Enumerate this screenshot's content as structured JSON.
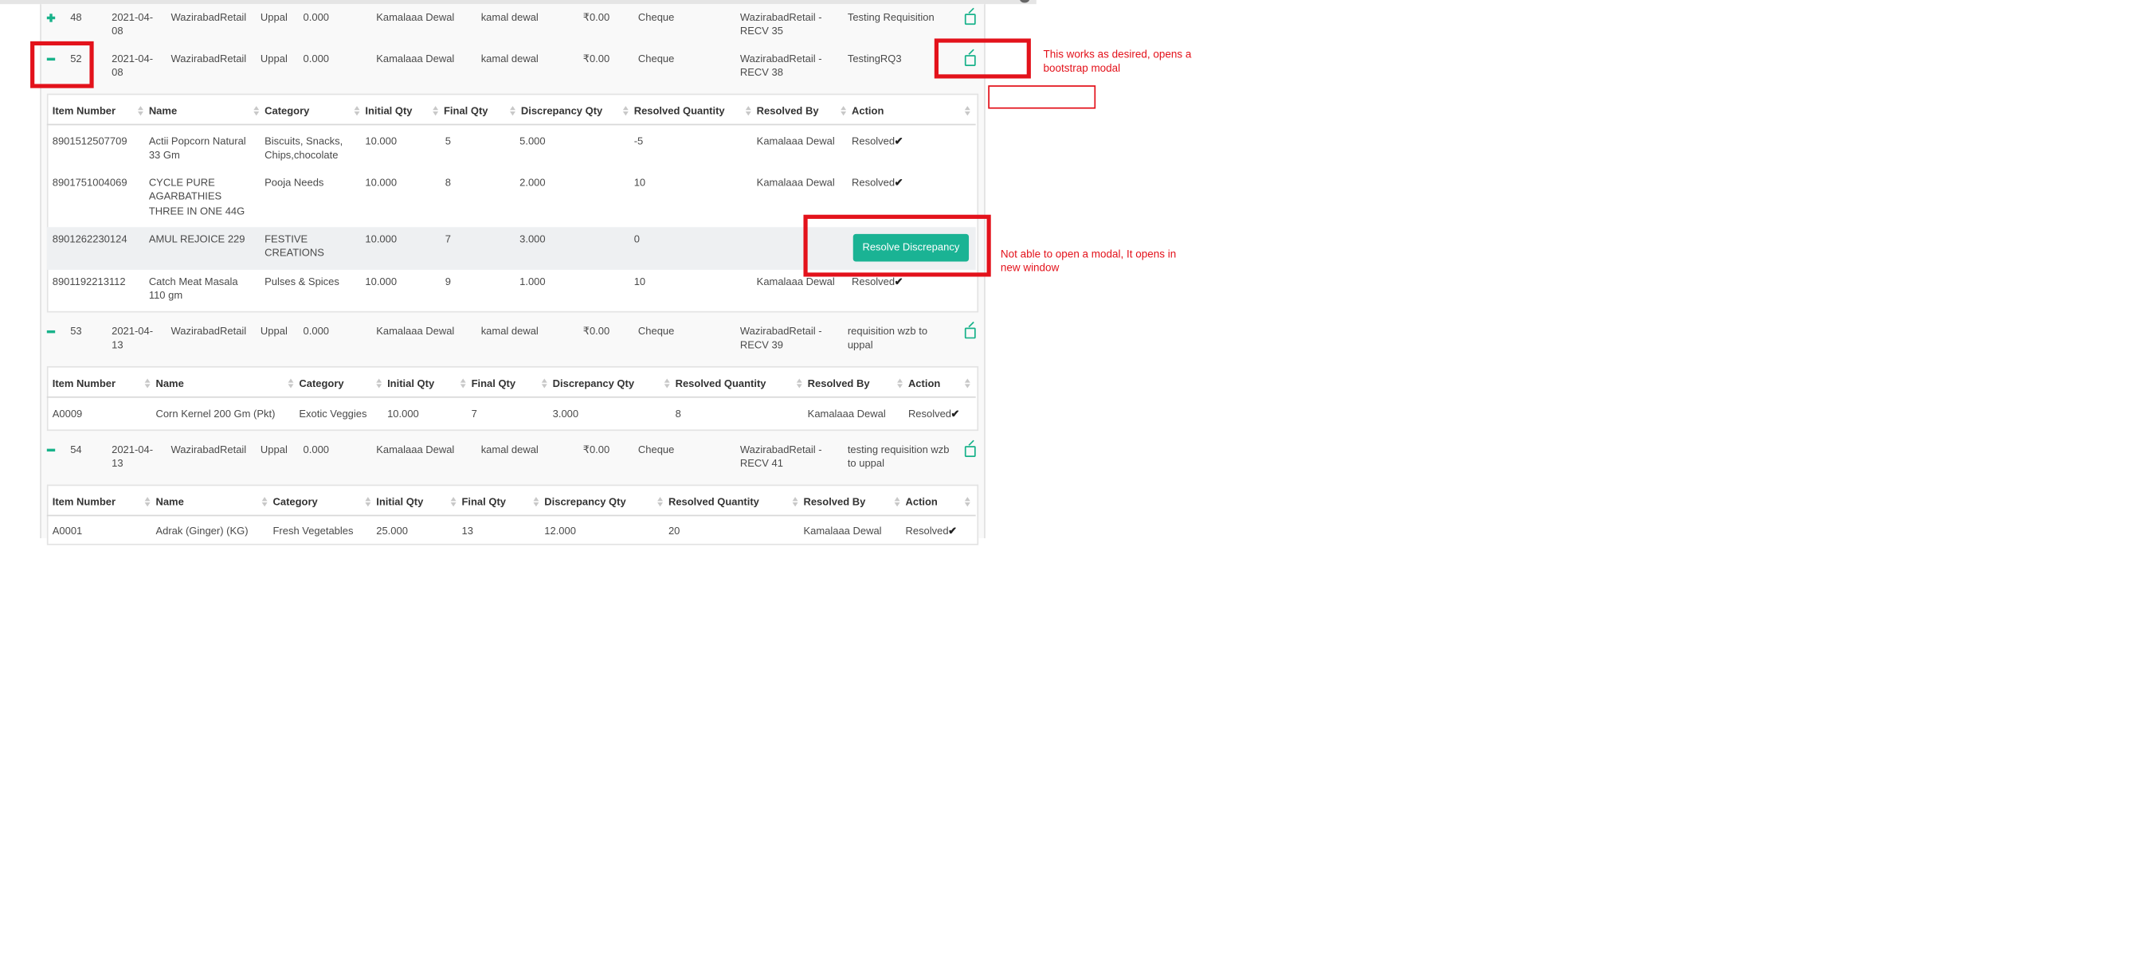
{
  "requisitions": [
    {
      "id": "48",
      "date": [
        "2021-04-",
        "08"
      ],
      "from": "WazirabadRetail",
      "to": "Uppal",
      "qty": "0.000",
      "approved_by": "Kamalaaa Dewal",
      "user": "kamal dewal",
      "amount": "₹0.00",
      "mode": "Cheque",
      "recv": [
        "WazirabadRetail -",
        "RECV 35"
      ],
      "remark": [
        "Testing Requisition"
      ],
      "toggle": "plus"
    },
    {
      "id": "52",
      "date": [
        "2021-04-",
        "08"
      ],
      "from": "WazirabadRetail",
      "to": "Uppal",
      "qty": "0.000",
      "approved_by": "Kamalaaa Dewal",
      "user": "kamal dewal",
      "amount": "₹0.00",
      "mode": "Cheque",
      "recv": [
        "WazirabadRetail -",
        "RECV 38"
      ],
      "remark": [
        "TestingRQ3"
      ],
      "toggle": "minus"
    },
    {
      "id": "53",
      "date": [
        "2021-04-",
        "13"
      ],
      "from": "WazirabadRetail",
      "to": "Uppal",
      "qty": "0.000",
      "approved_by": "Kamalaaa Dewal",
      "user": "kamal dewal",
      "amount": "₹0.00",
      "mode": "Cheque",
      "recv": [
        "WazirabadRetail -",
        "RECV 39"
      ],
      "remark": [
        "requisition wzb to",
        "uppal"
      ],
      "toggle": "minus"
    },
    {
      "id": "54",
      "date": [
        "2021-04-",
        "13"
      ],
      "from": "WazirabadRetail",
      "to": "Uppal",
      "qty": "0.000",
      "approved_by": "Kamalaaa Dewal",
      "user": "kamal dewal",
      "amount": "₹0.00",
      "mode": "Cheque",
      "recv": [
        "WazirabadRetail -",
        "RECV 41"
      ],
      "remark": [
        "testing requisition wzb",
        "to uppal"
      ],
      "toggle": "minus"
    }
  ],
  "subtable_headers": [
    "Item Number",
    "Name",
    "Category",
    "Initial Qty",
    "Final Qty",
    "Discrepancy Qty",
    "Resolved Quantity",
    "Resolved By",
    "Action"
  ],
  "subtable_52": [
    {
      "item": "8901512507709",
      "name": [
        "Actii Popcorn Natural",
        "33 Gm"
      ],
      "category": [
        "Biscuits, Snacks,",
        "Chips,chocolate"
      ],
      "initial": "10.000",
      "final": "5",
      "discrepancy": "5.000",
      "resolved_qty": "-5",
      "resolved_by": "Kamalaaa Dewal",
      "action": "Resolved"
    },
    {
      "item": "8901751004069",
      "name": [
        "CYCLE PURE",
        "AGARBATHIES",
        "THREE IN ONE 44G"
      ],
      "category": [
        "Pooja Needs"
      ],
      "initial": "10.000",
      "final": "8",
      "discrepancy": "2.000",
      "resolved_qty": "10",
      "resolved_by": "Kamalaaa Dewal",
      "action": "Resolved"
    },
    {
      "item": "8901262230124",
      "name": [
        "AMUL REJOICE 229"
      ],
      "category": [
        "FESTIVE",
        "CREATIONS"
      ],
      "initial": "10.000",
      "final": "7",
      "discrepancy": "3.000",
      "resolved_qty": "0",
      "resolved_by": "",
      "action": "",
      "button": "Resolve Discrepancy"
    },
    {
      "item": "8901192213112",
      "name": [
        "Catch Meat Masala",
        "110 gm"
      ],
      "category": [
        "Pulses & Spices"
      ],
      "initial": "10.000",
      "final": "9",
      "discrepancy": "1.000",
      "resolved_qty": "10",
      "resolved_by": "Kamalaaa Dewal",
      "action": "Resolved"
    }
  ],
  "subtable_53": [
    {
      "item": "A0009",
      "name": [
        "Corn Kernel 200 Gm (Pkt)"
      ],
      "category": [
        "Exotic Veggies"
      ],
      "initial": "10.000",
      "final": "7",
      "discrepancy": "3.000",
      "resolved_qty": "8",
      "resolved_by": "Kamalaaa Dewal",
      "action": "Resolved"
    }
  ],
  "subtable_54": [
    {
      "item": "A0001",
      "name": [
        "Adrak (Ginger) (KG)"
      ],
      "category": [
        "Fresh Vegetables"
      ],
      "initial": "25.000",
      "final": "13",
      "discrepancy": "12.000",
      "resolved_qty": "20",
      "resolved_by": "Kamalaaa Dewal",
      "action": "Resolved"
    }
  ],
  "check_glyph": "✔",
  "annotations": {
    "works": [
      "This works as desired, opens a",
      "bootstrap modal"
    ],
    "not_working": [
      "Not able to open a modal, It opens in",
      "new window"
    ]
  },
  "colors": {
    "accent": "#1ab394",
    "annotation": "#e3121b"
  },
  "icons": {
    "expand": "plus-icon",
    "collapse": "minus-icon",
    "edit": "edit-icon",
    "check": "check-icon"
  }
}
